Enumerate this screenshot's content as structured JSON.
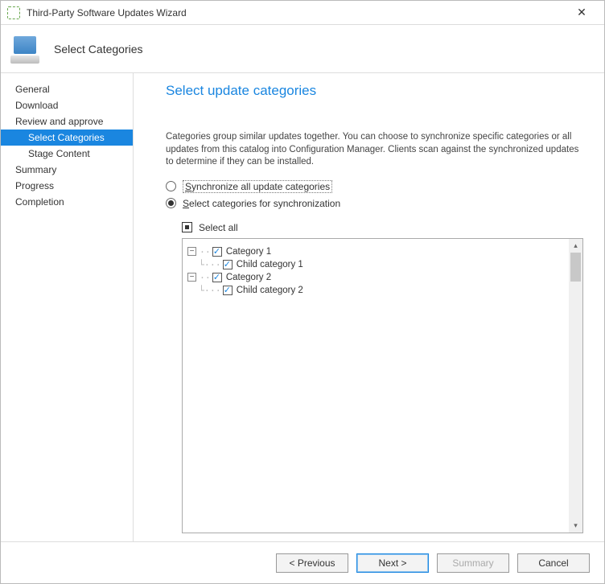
{
  "window": {
    "title": "Third-Party Software Updates Wizard",
    "close_glyph": "✕"
  },
  "header": {
    "step_label": "Select Categories"
  },
  "nav": {
    "items": [
      {
        "label": "General",
        "sub": false,
        "selected": false
      },
      {
        "label": "Download",
        "sub": false,
        "selected": false
      },
      {
        "label": "Review and approve",
        "sub": false,
        "selected": false
      },
      {
        "label": "Select Categories",
        "sub": true,
        "selected": true
      },
      {
        "label": "Stage Content",
        "sub": true,
        "selected": false
      },
      {
        "label": "Summary",
        "sub": false,
        "selected": false
      },
      {
        "label": "Progress",
        "sub": false,
        "selected": false
      },
      {
        "label": "Completion",
        "sub": false,
        "selected": false
      }
    ]
  },
  "page": {
    "title": "Select update categories",
    "description": "Categories group similar updates together. You can choose to synchronize specific categories or all updates from this catalog into Configuration Manager. Clients scan against the synchronized updates to determine if they can be installed.",
    "radios": {
      "sync_all": {
        "label_prefix": "S",
        "label_rest": "ynchronize all update categories",
        "checked": false,
        "focused": true
      },
      "select": {
        "label_prefix": "S",
        "label_rest": "elect categories for synchronization",
        "checked": true
      }
    },
    "select_all_label": "Select all",
    "select_all_state": "indeterminate",
    "tree": [
      {
        "label": "Category 1",
        "checked": true,
        "expanded": true,
        "children": [
          {
            "label": "Child category 1",
            "checked": true
          }
        ]
      },
      {
        "label": "Category 2",
        "checked": true,
        "expanded": true,
        "children": [
          {
            "label": "Child category 2",
            "checked": true
          }
        ]
      }
    ]
  },
  "footer": {
    "previous": "< Previous",
    "next": "Next >",
    "summary": "Summary",
    "cancel": "Cancel"
  }
}
